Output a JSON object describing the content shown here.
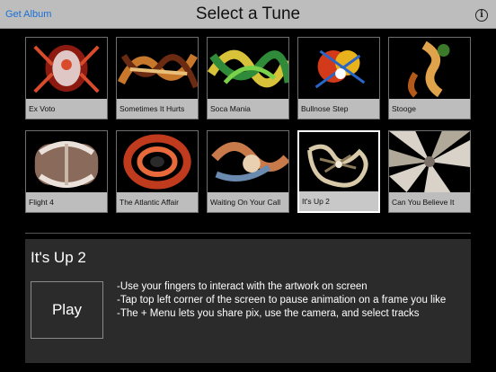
{
  "header": {
    "get_album_label": "Get Album",
    "title": "Select a Tune",
    "info_icon": "info-icon"
  },
  "tunes": [
    {
      "title": "Ex Voto",
      "palette": [
        "#d94b2b",
        "#f2f2f2",
        "#8c1a10"
      ],
      "selected": false
    },
    {
      "title": "Sometimes It Hurts",
      "palette": [
        "#c8782a",
        "#6b2a12",
        "#e9c07a"
      ],
      "selected": false
    },
    {
      "title": "Soca Mania",
      "palette": [
        "#2f8a3a",
        "#d7c23a",
        "#7ad14a"
      ],
      "selected": false
    },
    {
      "title": "Bullnose Step",
      "palette": [
        "#e8b21c",
        "#d23a1a",
        "#2a66c8"
      ],
      "selected": false
    },
    {
      "title": "Stooge",
      "palette": [
        "#e0a24a",
        "#3a7a2a",
        "#b35a1a"
      ],
      "selected": false
    },
    {
      "title": "Flight 4",
      "palette": [
        "#c9b8a8",
        "#8a6a5a",
        "#eae2da"
      ],
      "selected": false
    },
    {
      "title": "The Atlantic Affair",
      "palette": [
        "#c03a1e",
        "#2a2a2a",
        "#e86a3a"
      ],
      "selected": false
    },
    {
      "title": "Waiting On Your Call",
      "palette": [
        "#c87a4a",
        "#6a8ab0",
        "#e8d0b0"
      ],
      "selected": false
    },
    {
      "title": "It's Up 2",
      "palette": [
        "#d8c9a8",
        "#8a7a5a",
        "#f2ead8"
      ],
      "selected": true
    },
    {
      "title": "Can You Believe It",
      "palette": [
        "#d8d2c8",
        "#7a7068",
        "#b0a898"
      ],
      "selected": false
    }
  ],
  "detail": {
    "title": "It's Up 2",
    "play_label": "Play",
    "instructions": [
      "-Use your fingers to interact with the artwork on screen",
      "-Tap top left corner of the screen to pause animation on a frame you like",
      "-The + Menu lets you share pix, use the camera, and select tracks"
    ]
  }
}
